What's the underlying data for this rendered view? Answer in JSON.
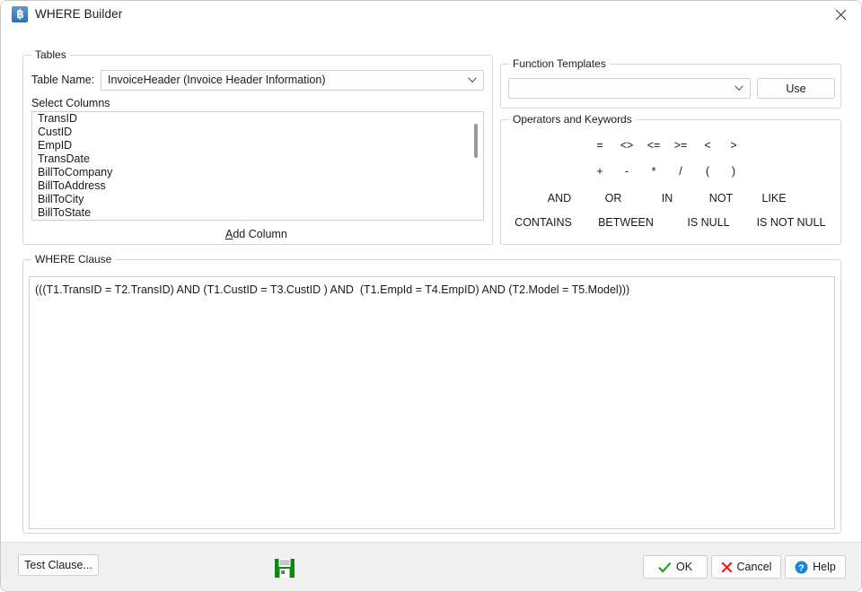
{
  "window": {
    "title": "WHERE Builder",
    "icon": "app-icon",
    "close_label": "×"
  },
  "tables": {
    "group_title": "Tables",
    "table_name_label": "Table Name:",
    "table_name_value": "InvoiceHeader  (Invoice Header Information)",
    "select_columns_label": "Select Columns",
    "columns": [
      "TransID",
      "CustID",
      "EmpID",
      "TransDate",
      "BillToCompany",
      "BillToAddress",
      "BillToCity",
      "BillToState"
    ],
    "add_column_accel": "A",
    "add_column_rest": "dd Column"
  },
  "function_templates": {
    "group_title": "Function Templates",
    "selected_value": "",
    "use_label": "Use"
  },
  "operators": {
    "group_title": "Operators and Keywords",
    "row1": [
      "=",
      "<>",
      "<=",
      ">=",
      "<",
      ">"
    ],
    "row2": [
      "+",
      "-",
      "*",
      "/",
      "(",
      ")"
    ],
    "row3": [
      "AND",
      "OR",
      "IN",
      "NOT",
      "LIKE"
    ],
    "row4": [
      "CONTAINS",
      "BETWEEN",
      "IS NULL",
      "IS NOT NULL"
    ]
  },
  "where_clause": {
    "group_title": "WHERE Clause",
    "value": "(((T1.TransID = T2.TransID) AND (T1.CustID = T3.CustID ) AND  (T1.EmpId = T4.EmpID) AND (T2.Model = T5.Model)))"
  },
  "footer": {
    "test_clause_label": "Test Clause...",
    "save_icon": "floppy-save-icon",
    "ok_label": "OK",
    "cancel_label": "Cancel",
    "help_label": "Help"
  },
  "colors": {
    "accent_blue": "#2f6fae",
    "ok_green": "#13a413",
    "cancel_red": "#e02020",
    "help_blue": "#1c85d6",
    "save_green": "#0a8a12",
    "dialog_bg": "#ffffff",
    "footer_bg": "#f0f0f0"
  }
}
